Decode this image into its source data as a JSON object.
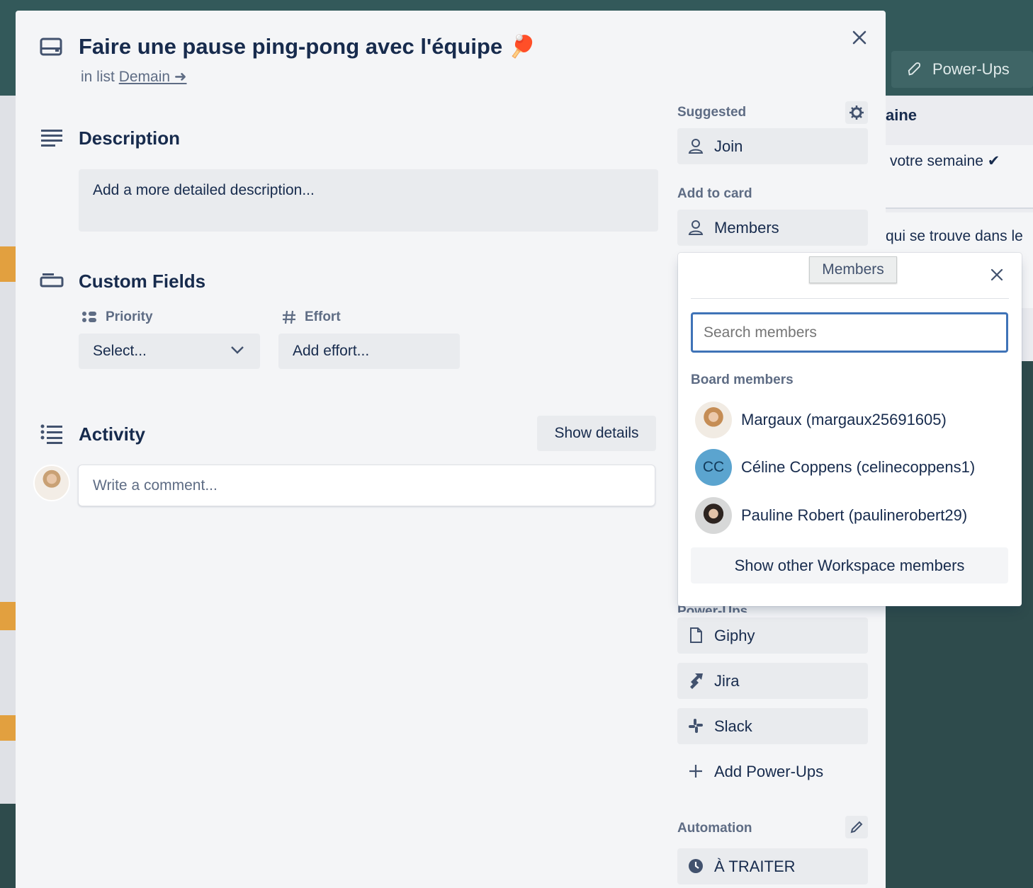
{
  "background": {
    "powerups_label": "Power-Ups",
    "column_header": "aine",
    "card1_text": "votre semaine ✔",
    "card2_text": "qui se trouve dans le"
  },
  "card": {
    "title": "Faire une pause ping-pong avec l'équipe 🏓",
    "in_list_prefix": "in list",
    "list_name": "Demain ➜"
  },
  "description": {
    "title": "Description",
    "placeholder": "Add a more detailed description..."
  },
  "custom_fields": {
    "title": "Custom Fields",
    "priority_label": "Priority",
    "priority_value": "Select...",
    "effort_label": "Effort",
    "effort_value": "Add effort..."
  },
  "activity": {
    "title": "Activity",
    "show_details": "Show details",
    "comment_placeholder": "Write a comment..."
  },
  "sidebar": {
    "suggested_label": "Suggested",
    "join_label": "Join",
    "add_to_card_label": "Add to card",
    "members_label": "Members",
    "powerups_partial": "Power-Ups",
    "powerups": [
      {
        "label": "Giphy",
        "icon": "file-icon"
      },
      {
        "label": "Jira",
        "icon": "jira-icon"
      },
      {
        "label": "Slack",
        "icon": "slack-icon"
      }
    ],
    "add_powerups_label": "Add Power-Ups",
    "automation_label": "Automation",
    "automation_button": "À TRAITER"
  },
  "members_popover": {
    "title": "Members",
    "search_placeholder": "Search members",
    "section_label": "Board members",
    "members": [
      {
        "name": "Margaux (margaux25691605)",
        "initials": ""
      },
      {
        "name": "Céline Coppens (celinecoppens1)",
        "initials": "CC"
      },
      {
        "name": "Pauline Robert (paulinerobert29)",
        "initials": ""
      }
    ],
    "show_other": "Show other Workspace members"
  },
  "colors": {
    "accent_blue": "#3f73b7",
    "avatar_cc": "#5ba4cf",
    "modal_bg": "#f4f5f7",
    "board_bg": "#2e4b4c"
  }
}
